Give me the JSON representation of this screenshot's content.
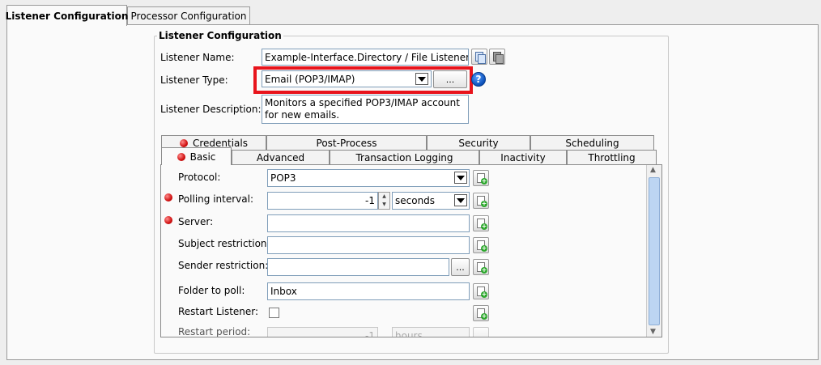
{
  "tabs": {
    "listener": "Listener Configuration",
    "processor": "Processor Configuration"
  },
  "group": {
    "legend": "Listener Configuration"
  },
  "listener_name": {
    "label": "Listener Name:",
    "value": "Example-Interface.Directory / File Listener"
  },
  "listener_type": {
    "label": "Listener Type:",
    "value": "Email (POP3/IMAP)",
    "browse": "..."
  },
  "listener_desc": {
    "label": "Listener Description:",
    "value": "Monitors a specified POP3/IMAP account for new emails."
  },
  "inner_tabs_row1": [
    "Credentials",
    "Post-Process",
    "Security",
    "Scheduling"
  ],
  "inner_tabs_row2": [
    "Basic",
    "Advanced",
    "Transaction Logging",
    "Inactivity",
    "Throttling"
  ],
  "fields": {
    "protocol": {
      "label": "Protocol:",
      "value": "POP3"
    },
    "polling": {
      "label": "Polling interval:",
      "value": "-1",
      "unit": "seconds"
    },
    "server": {
      "label": "Server:",
      "value": ""
    },
    "subject": {
      "label": "Subject restriction:",
      "value": ""
    },
    "sender": {
      "label": "Sender restriction:",
      "value": "",
      "browse": "..."
    },
    "folder": {
      "label": "Folder to poll:",
      "value": "Inbox"
    },
    "restart_listener": {
      "label": "Restart Listener:",
      "checked": false
    },
    "restart_period": {
      "label": "Restart period:",
      "value": "-1",
      "unit": "hours"
    }
  },
  "icons": {
    "copy": "copy-icon",
    "paste": "paste-icon",
    "help": "help-icon",
    "add": "add-variable-icon",
    "required": "required-indicator-icon"
  },
  "colors": {
    "highlight": "#e8141c",
    "required": "#d01010"
  }
}
